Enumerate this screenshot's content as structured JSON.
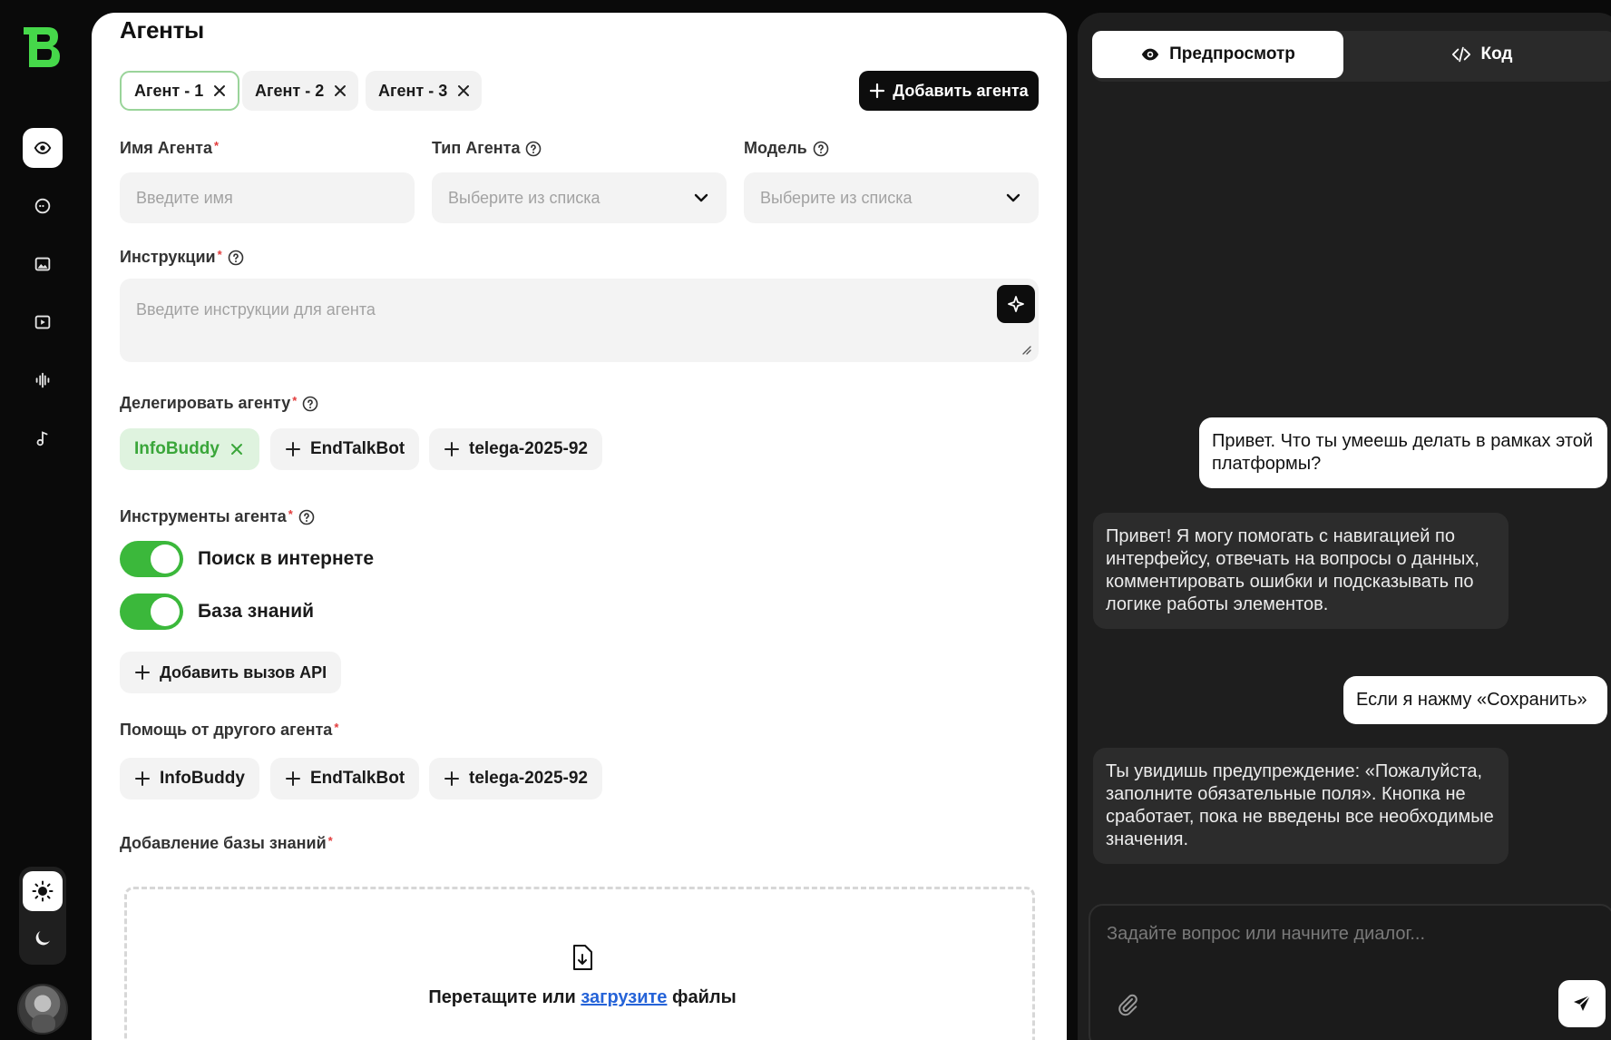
{
  "page": {
    "title": "Агенты"
  },
  "tabs": [
    {
      "label": "Агент - 1",
      "active": true
    },
    {
      "label": "Агент - 2",
      "active": false
    },
    {
      "label": "Агент - 3",
      "active": false
    }
  ],
  "toolbar": {
    "add_agent_label": "Добавить агента"
  },
  "form": {
    "name": {
      "label": "Имя Агента",
      "placeholder": "Введите имя",
      "required": "*"
    },
    "type": {
      "label": "Тип Агента",
      "placeholder": "Выберите из списка"
    },
    "model": {
      "label": "Модель",
      "placeholder": "Выберите из списка"
    },
    "instructions": {
      "label": "Инструкции",
      "placeholder": "Введите инструкции для агента",
      "required": "*"
    },
    "delegate": {
      "label": "Делегировать агенту",
      "required": "*",
      "chips": [
        {
          "label": "InfoBuddy",
          "selected": true
        },
        {
          "label": "EndTalkBot",
          "selected": false
        },
        {
          "label": "telega-2025-92",
          "selected": false
        }
      ]
    },
    "tools": {
      "label": "Инструменты агента",
      "required": "*",
      "toggles": [
        {
          "label": "Поиск в интернете",
          "on": true
        },
        {
          "label": "База знаний",
          "on": true
        }
      ],
      "add_api_label": "Добавить вызов API"
    },
    "help_from": {
      "label": "Помощь от другого агента",
      "required": "*",
      "chips": [
        "InfoBuddy",
        "EndTalkBot",
        "telega-2025-92"
      ]
    },
    "knowledge": {
      "label": "Добавление базы знаний",
      "required": "*",
      "drop_text_before": "Перетащите или",
      "drop_link": "загрузите",
      "drop_text_after": "файлы"
    }
  },
  "preview": {
    "tabs": {
      "preview": "Предпросмотр",
      "code": "Код"
    },
    "messages": [
      {
        "role": "user",
        "text": "Привет. Что ты умеешь делать в рамках этой платформы?"
      },
      {
        "role": "bot",
        "text": "Привет! Я могу помогать с навигацией по интерфейсу, отвечать на вопросы о данных, комментировать ошибки и подсказывать по логике работы элементов."
      },
      {
        "role": "user",
        "text": "Если я нажму «Сохранить»"
      },
      {
        "role": "bot",
        "text": "Ты увидишь предупреждение: «Пожалуйста, заполните обязательные поля». Кнопка не сработает, пока не введены все необходимые значения."
      }
    ],
    "composer_placeholder": "Задайте вопрос или начните диалог..."
  },
  "colors": {
    "brand_green": "#3bb83b",
    "selected_chip_bg": "#dff3df",
    "required_red": "#e23b3b",
    "link_blue": "#2563d8"
  },
  "icons": {
    "rail": [
      "agents-eye-icon",
      "chat-icon",
      "image-icon",
      "video-icon",
      "audio-wave-icon",
      "music-note-icon"
    ],
    "theme": [
      "sun-icon",
      "moon-icon"
    ]
  }
}
